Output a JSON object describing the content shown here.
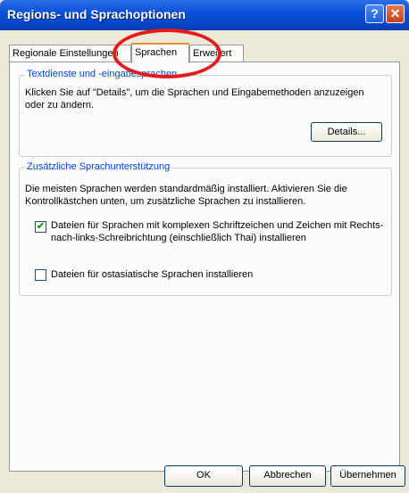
{
  "window": {
    "title": "Regions- und Sprachoptionen",
    "help_glyph": "?",
    "close_glyph": "✕"
  },
  "tabs": [
    {
      "label": "Regionale Einstellungen"
    },
    {
      "label": "Sprachen"
    },
    {
      "label": "Erweitert"
    }
  ],
  "groups": {
    "textdienste": {
      "title": "Textdienste und -eingabesprachen",
      "description": "Klicken Sie auf \"Details\", um die Sprachen und Eingabemethoden anzuzeigen oder zu ändern.",
      "details_button": "Details..."
    },
    "zusatz": {
      "title": "Zusätzliche Sprachunterstützung",
      "description": "Die meisten Sprachen werden standardmäßig installiert. Aktivieren Sie die Kontrollkästchen unten, um zusätzliche Sprachen zu installieren.",
      "checkboxes": [
        {
          "label": "Dateien für Sprachen mit komplexen Schriftzeichen und Zeichen mit Rechts-nach-links-Schreibrichtung (einschließlich Thai) installieren",
          "checked": true,
          "mark": "✔"
        },
        {
          "label": "Dateien für ostasiatische Sprachen installieren",
          "checked": false,
          "mark": ""
        }
      ]
    }
  },
  "footer": {
    "ok": "OK",
    "cancel": "Abbrechen",
    "apply": "Übernehmen"
  },
  "annotation": {
    "color": "#e41b1b"
  }
}
